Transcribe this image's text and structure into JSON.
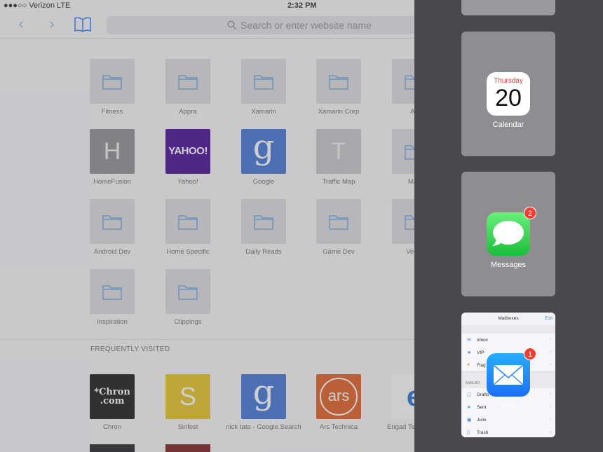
{
  "status_bar": {
    "carrier": "●●●○○ Verizon  LTE",
    "time": "2:32 PM"
  },
  "toolbar": {
    "search_placeholder": "Search or enter website name"
  },
  "favorites": [
    {
      "label": "Fitness",
      "kind": "folder"
    },
    {
      "label": "Appra",
      "kind": "folder"
    },
    {
      "label": "Xamarin",
      "kind": "folder"
    },
    {
      "label": "Xamarin Corp",
      "kind": "folder"
    },
    {
      "label": "Ap",
      "kind": "folder"
    },
    {
      "label": "HomeFusion",
      "kind": "letter",
      "letter": "H",
      "color": "#8c8c8e"
    },
    {
      "label": "Yahoo!",
      "kind": "yahoo",
      "logo": "YAHOO!",
      "color": "#400090"
    },
    {
      "label": "Google",
      "kind": "google",
      "letter": "g",
      "color": "#3b6fd7"
    },
    {
      "label": "Traffic Map",
      "kind": "letter",
      "letter": "T",
      "color": "#c6c6c9"
    },
    {
      "label": "Mac",
      "kind": "folder"
    },
    {
      "label": "Android Dev",
      "kind": "folder"
    },
    {
      "label": "Home Specific",
      "kind": "folder"
    },
    {
      "label": "Daily Reads",
      "kind": "folder"
    },
    {
      "label": "Game Dev",
      "kind": "folder"
    },
    {
      "label": "Vecto",
      "kind": "folder"
    },
    {
      "label": "Inspiration",
      "kind": "folder"
    },
    {
      "label": "Clippings",
      "kind": "folder"
    }
  ],
  "frequently_visited": {
    "title": "FREQUENTLY VISITED",
    "items": [
      {
        "label": "Chron",
        "logo": "*Chron\n.com",
        "color": "#111111"
      },
      {
        "label": "Sinfest",
        "letter": "S",
        "color": "#e7c21b"
      },
      {
        "label": "nick tate - Google Search",
        "letter": "g",
        "color": "#3b6fd7"
      },
      {
        "label": "Ars Technica",
        "letter": "ars",
        "color": "#e2571c"
      },
      {
        "label": "Engad Technology",
        "letter": "e",
        "color": "#ffffff"
      }
    ]
  },
  "switcher": {
    "apps": [
      {
        "name": "Calendar",
        "day": "Thursday",
        "date": "20"
      },
      {
        "name": "Messages",
        "badge": "2"
      },
      {
        "name": "Mail",
        "badge": "1"
      }
    ],
    "mail_preview": {
      "title": "Mailboxes",
      "edit": "Edit",
      "rows": [
        "Inbox",
        "VIP",
        "Flag",
        "Drafts",
        "Sent",
        "Junk",
        "Trash"
      ],
      "section": "MAILBO"
    }
  },
  "colors": {
    "accent": "#4c8fd6",
    "badge": "#fe3b30",
    "switcher_bg": "#48484a"
  }
}
